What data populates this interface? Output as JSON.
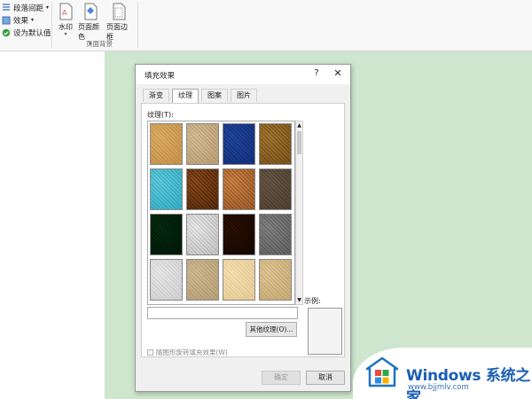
{
  "ribbon": {
    "small_items": [
      {
        "label": "段落间距",
        "arrow": "▾",
        "icon": "paragraph-spacing-icon"
      },
      {
        "label": "效果",
        "arrow": "▾",
        "icon": "effects-icon"
      },
      {
        "label": "设为默认值",
        "arrow": "",
        "icon": "check-icon"
      }
    ],
    "watermark_label": "水印",
    "page_color_label": "页面颜色",
    "page_border_label": "页面边框",
    "group_label": "页面背景"
  },
  "dialog": {
    "title": "填充效果",
    "help": "?",
    "close": "✕",
    "tabs": [
      "渐变",
      "纹理",
      "图案",
      "图片"
    ],
    "active_tab": 1,
    "texture_label": "纹理(T):",
    "name_value": "",
    "other_texture_button": "其他纹理(O)...",
    "sample_label": "示例:",
    "rotate_checkbox_label": "随图形旋转填充效果(W)",
    "rotate_checked": false,
    "ok_button": "确定",
    "cancel_button": "取消",
    "scroll_up": "▲",
    "scroll_down": "▼"
  },
  "textures": [
    {
      "name": "papyrus",
      "colors": [
        "#ecd3a2",
        "#d9b57c"
      ]
    },
    {
      "name": "canvas",
      "colors": [
        "#e9dcc4",
        "#cfbc9d"
      ]
    },
    {
      "name": "denim",
      "colors": [
        "#5b86c6",
        "#3b62a6"
      ]
    },
    {
      "name": "woven-mat",
      "colors": [
        "#cbae6e",
        "#9e7f44"
      ]
    },
    {
      "name": "water-droplets",
      "colors": [
        "#9fe3ec",
        "#5cc6d6"
      ]
    },
    {
      "name": "paper-bag",
      "colors": [
        "#bd8b54",
        "#7b5226"
      ]
    },
    {
      "name": "fish-fossil",
      "colors": [
        "#e3b784",
        "#b58454"
      ]
    },
    {
      "name": "sand",
      "colors": [
        "#a39585",
        "#7f7264"
      ]
    },
    {
      "name": "green-marble",
      "colors": [
        "#1f6a3e",
        "#0e3f22"
      ]
    },
    {
      "name": "white-marble",
      "colors": [
        "#f4f4f4",
        "#cfcfcf"
      ]
    },
    {
      "name": "brown-marble",
      "colors": [
        "#6b3f1c",
        "#3a200c"
      ]
    },
    {
      "name": "granite",
      "colors": [
        "#b6b6b6",
        "#8c8c8c"
      ]
    },
    {
      "name": "newsprint",
      "colors": [
        "#f3f3f3",
        "#dedede"
      ]
    },
    {
      "name": "recycled-paper",
      "colors": [
        "#e6dac3",
        "#cdbf9f"
      ]
    },
    {
      "name": "parchment",
      "colors": [
        "#faefd6",
        "#ecdcb8"
      ]
    },
    {
      "name": "stationery",
      "colors": [
        "#eee1c5",
        "#d8c59c"
      ]
    }
  ],
  "watermark": {
    "title": "Windows 系统之家",
    "url": "www.bjjmlv.com",
    "logo_colors": [
      "#ea4a3a",
      "#2ca84b",
      "#2d8ce0",
      "#f7b300"
    ]
  }
}
